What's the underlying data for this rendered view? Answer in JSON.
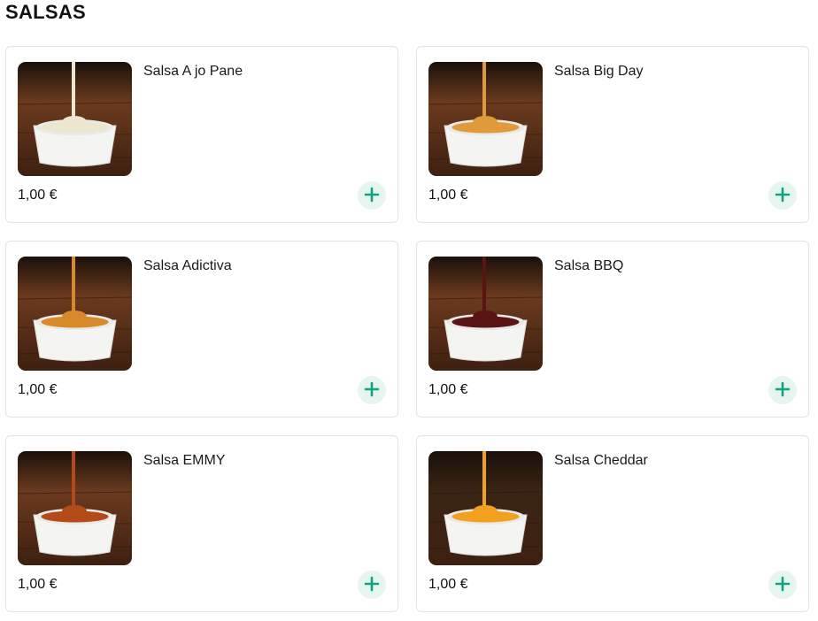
{
  "section": {
    "title": "SALSAS"
  },
  "accent_color": "#12a37f",
  "products": [
    {
      "name": "Salsa A jo Pane",
      "price": "1,00 €",
      "image": "garlic-mayo-sauce-bowl",
      "sauce_color": "#ece6d0",
      "bg_color": "#6b3a1e"
    },
    {
      "name": "Salsa Big Day",
      "price": "1,00 €",
      "image": "big-day-sauce-bowl",
      "sauce_color": "#e09a3a",
      "bg_color": "#6b3a1e"
    },
    {
      "name": "Salsa Adictiva",
      "price": "1,00 €",
      "image": "adictiva-sauce-bowl",
      "sauce_color": "#d88a2a",
      "bg_color": "#6b3a1e"
    },
    {
      "name": "Salsa BBQ",
      "price": "1,00 €",
      "image": "bbq-sauce-bowl",
      "sauce_color": "#5a1414",
      "bg_color": "#6b3a1e"
    },
    {
      "name": "Salsa EMMY",
      "price": "1,00 €",
      "image": "emmy-sauce-bowl",
      "sauce_color": "#b44a18",
      "bg_color": "#6b3a1e"
    },
    {
      "name": "Salsa Cheddar",
      "price": "1,00 €",
      "image": "cheddar-sauce-bowl",
      "sauce_color": "#f2a020",
      "bg_color": "#3a2414"
    }
  ]
}
